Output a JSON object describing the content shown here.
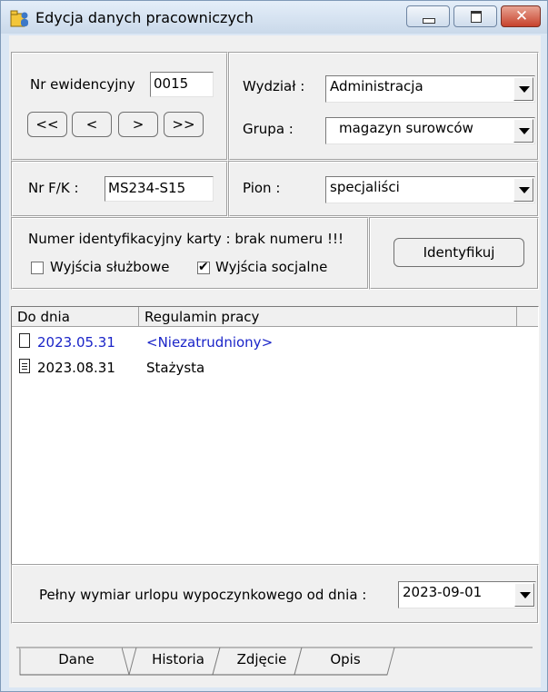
{
  "window": {
    "title": "Edycja danych pracowniczych"
  },
  "icons": {
    "app": "folder-person-icon",
    "minimize": "minimize-icon",
    "maximize": "maximize-icon",
    "close": "close-icon",
    "document": "document-icon"
  },
  "ids": {
    "nr_ewid_label": "Nr ewidencyjny",
    "nr_ewid_value": "0015",
    "nav": [
      "<<",
      "<",
      ">",
      ">>"
    ],
    "nr_fk_label": "Nr F/K :",
    "nr_fk_value": "MS234-S15"
  },
  "org": {
    "wydzial_label": "Wydział :",
    "wydzial_value": "Administracja",
    "grupa_label": "Grupa :",
    "grupa_value": "magazyn surowców",
    "pion_label": "Pion :",
    "pion_value": "specjaliści"
  },
  "card": {
    "text": "Numer identyfikacyjny karty :  brak numeru !!!",
    "wyjscia_sluzbowe_label": "Wyjścia służbowe",
    "wyjscia_sluzbowe_checked": false,
    "wyjscia_socjalne_label": "Wyjścia socjalne",
    "wyjscia_socjalne_checked": true,
    "identify_button": "Identyfikuj"
  },
  "history": {
    "columns": [
      "Do dnia",
      "Regulamin pracy"
    ],
    "rows": [
      {
        "date": "2023.05.31",
        "regulamin": "<Niezatrudniony>"
      },
      {
        "date": "2023.08.31",
        "regulamin": "Stażysta"
      }
    ]
  },
  "leave": {
    "label": "Pełny wymiar urlopu wypoczynkowego od dnia :",
    "value": "2023-09-01"
  },
  "tabs": [
    "Dane",
    "Historia",
    "Zdjęcie",
    "Opis"
  ],
  "colors": {
    "highlight_text": "#1a24c8",
    "title_bar": "#cad9ea",
    "close_button": "#c7422c"
  }
}
